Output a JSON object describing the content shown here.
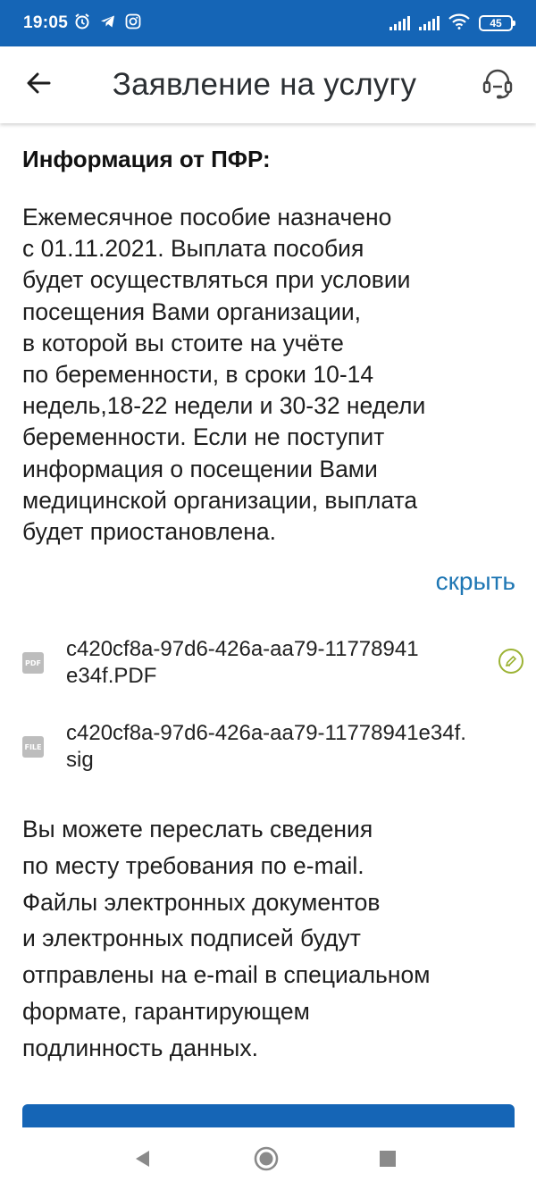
{
  "status_bar": {
    "time": "19:05",
    "battery": "45",
    "left_icons": [
      "alarm-icon",
      "telegram-icon",
      "instagram-icon"
    ],
    "right_icons": [
      "signal-icon",
      "signal-icon",
      "wifi-icon",
      "battery-icon"
    ]
  },
  "app_bar": {
    "title": "Заявление на услугу",
    "back_icon": "arrow-left-icon",
    "support_icon": "headset-icon"
  },
  "info": {
    "heading": "Информация от ПФР:",
    "text": "Ежемесячное пособие назначено\nс 01.11.2021. Выплата пособия\nбудет осуществляться при условии\nпосещения Вами организации,\nв которой вы стоите на учёте\nпо беременности, в сроки 10-14\nнедель,18-22 недели и 30-32 недели\nбеременности. Если не поступит\nинформация о посещении Вами\nмедицинской организации, выплата\nбудет приостановлена.",
    "hide_link": "скрыть"
  },
  "files": [
    {
      "icon_label": "PDF",
      "name": "c420cf8a-97d6-426a-aa79-11778941\ne34f.PDF",
      "has_signature": true
    },
    {
      "icon_label": "FILE",
      "name": "c420cf8a-97d6-426a-aa79-11778941e34f.\nsig",
      "has_signature": false
    }
  ],
  "forward_text": "Вы можете переслать сведения\nпо месту требования по e-mail.\nФайлы электронных документов\nи электронных подписей будут\nотправлены на e-mail в специальном\nформате, гарантирующем\nподлинность данных.",
  "colors": {
    "brand_blue": "#1565b6",
    "link_blue": "#1f77b4",
    "signature_green": "#9cb334",
    "file_icon_gray": "#bdbdbd"
  },
  "nav": {
    "icons": [
      "nav-back-icon",
      "nav-home-icon",
      "nav-recents-icon"
    ]
  }
}
